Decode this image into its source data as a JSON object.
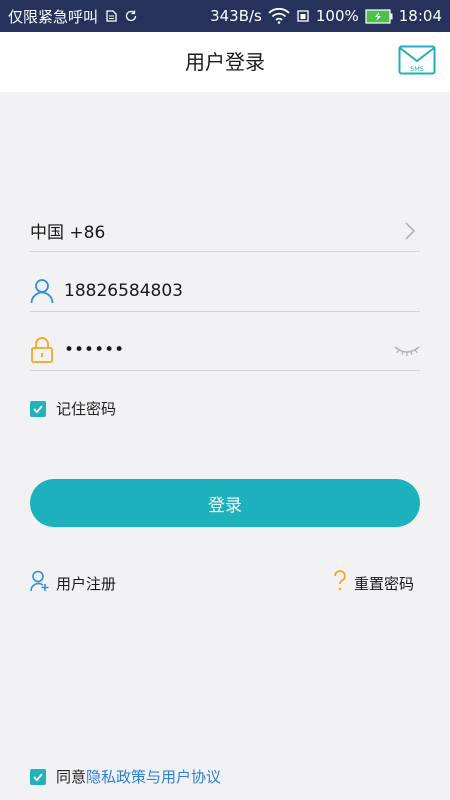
{
  "status_bar": {
    "carrier": "仅限紧急呼叫",
    "speed": "343B/s",
    "battery_percent": "100%",
    "time": "18:04"
  },
  "app_bar": {
    "title": "用户登录",
    "sms_icon_text": "SMS"
  },
  "form": {
    "country_code": "中国 +86",
    "phone_value": "18826584803",
    "password_value": "••••••",
    "remember_label": "记住密码",
    "remember_checked": true
  },
  "actions": {
    "login_label": "登录",
    "register_label": "用户注册",
    "reset_label": "重置密码"
  },
  "agreement": {
    "prefix": "同意",
    "link_text": "隐私政策与用户协议",
    "checked": true
  },
  "colors": {
    "accent": "#1cb1bd",
    "status_bar": "#27325c",
    "link": "#2e7fd6",
    "icon_blue": "#2f8de4",
    "icon_orange": "#f5a623"
  }
}
